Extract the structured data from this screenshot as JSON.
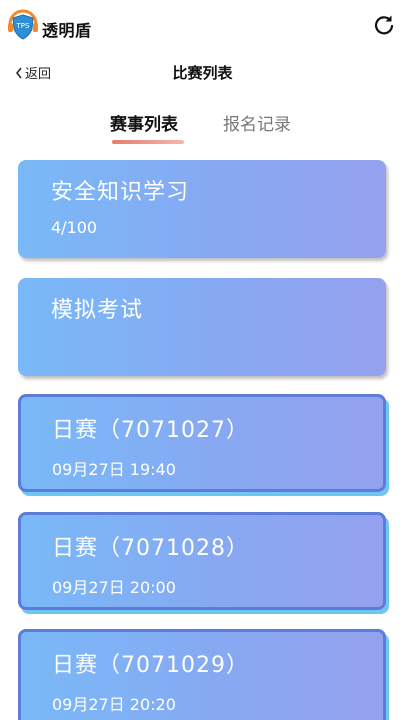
{
  "app": {
    "brand": "透明盾",
    "logo_text": "TPS"
  },
  "nav": {
    "back_label": "返回",
    "title": "比赛列表"
  },
  "tabs": [
    {
      "label": "赛事列表",
      "active": true
    },
    {
      "label": "报名记录",
      "active": false
    }
  ],
  "cards": [
    {
      "title": "安全知识学习",
      "subtitle": "4/100"
    },
    {
      "title": "模拟考试",
      "subtitle": ""
    },
    {
      "title": "日赛（7071027）",
      "subtitle": "09月27日 19:40"
    },
    {
      "title": "日赛（7071028）",
      "subtitle": "09月27日 20:00"
    },
    {
      "title": "日赛（7071029）",
      "subtitle": "09月27日 20:20"
    }
  ],
  "colors": {
    "card_gradient_start": "#79b9f8",
    "card_gradient_end": "#94a1ee",
    "tab_accent": "#e87c6c",
    "logo_orange": "#f08a2c",
    "logo_blue": "#2d8fd5"
  },
  "icons": {
    "logo": "shield-logo-icon",
    "refresh": "refresh-icon",
    "back": "chevron-left-icon"
  }
}
